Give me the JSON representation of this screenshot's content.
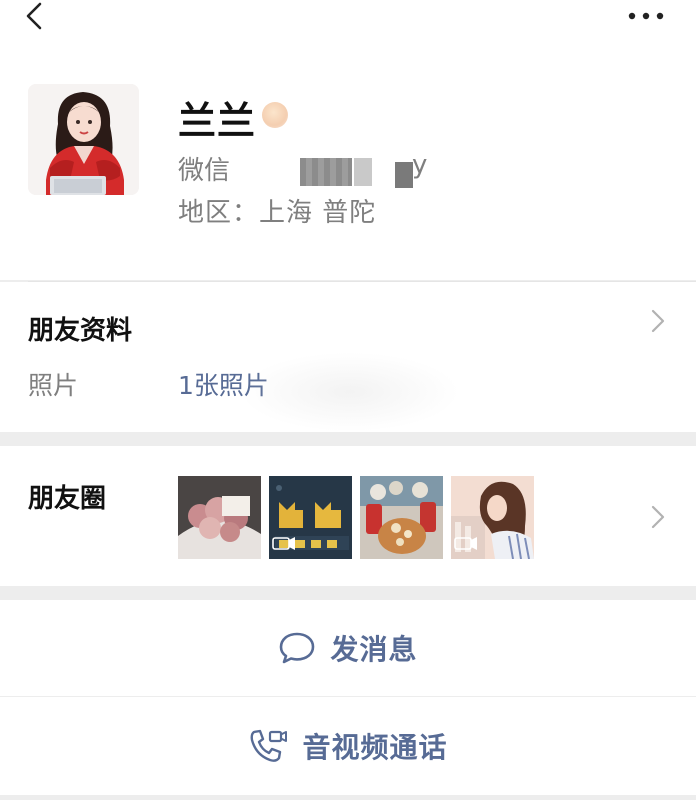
{
  "header": {
    "back_icon": "back-chevron-icon",
    "more_icon": "more-dots-icon"
  },
  "profile": {
    "name": "兰兰",
    "wechat_id_label": "微信",
    "wechat_id_suffix": "y",
    "region": "地区：上海  普陀"
  },
  "friend_info": {
    "title": "朋友资料",
    "photos_label": "照片",
    "photos_value": "1张照片"
  },
  "moments": {
    "title": "朋友圈",
    "thumbnails": [
      "flower-bouquet-photo",
      "cat-cookies-video",
      "gift-basket-photo",
      "illustrated-girl-video"
    ]
  },
  "actions": {
    "send_message": "发消息",
    "voice_video_call": "音视频通话"
  },
  "colors": {
    "link_blue": "#576b95",
    "secondary_text": "#7f7f7f",
    "background": "#ededed"
  }
}
